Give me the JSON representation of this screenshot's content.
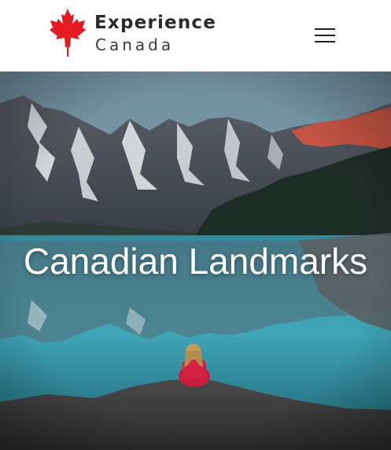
{
  "brand": {
    "name_line1": "Experience",
    "name_line2": "Canada",
    "logo_icon": "maple-leaf-icon",
    "leaf_color": "#e31b23"
  },
  "header": {
    "menu_icon": "hamburger-menu-icon"
  },
  "hero": {
    "title": "Canadian Landmarks",
    "image": "mountain-lake-photo"
  }
}
